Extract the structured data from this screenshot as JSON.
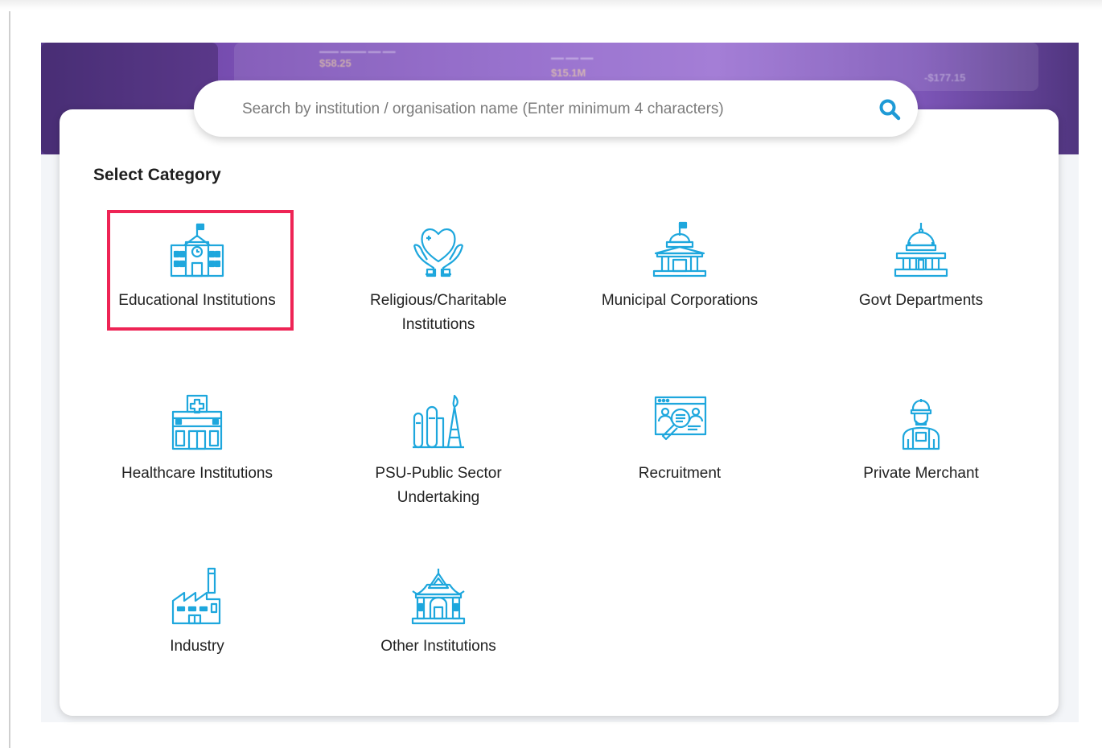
{
  "banner": {
    "metric_1": "$58.25",
    "metric_2": "$15.1M",
    "metric_3": "-$177.15"
  },
  "search": {
    "placeholder": "Search by institution / organisation name (Enter minimum 4 characters)",
    "icon": "search-icon"
  },
  "section_title": "Select Category",
  "categories": [
    {
      "label": "Educational Institutions",
      "icon": "school-icon",
      "selected": true
    },
    {
      "label": "Religious/Charitable Institutions",
      "icon": "heart-hands-icon"
    },
    {
      "label": "Municipal Corporations",
      "icon": "municipal-building-icon"
    },
    {
      "label": "Govt Departments",
      "icon": "capitol-dome-icon"
    },
    {
      "label": "Healthcare Institutions",
      "icon": "hospital-icon"
    },
    {
      "label": "PSU-Public Sector Undertaking",
      "icon": "oil-refinery-icon"
    },
    {
      "label": "Recruitment",
      "icon": "recruitment-search-icon"
    },
    {
      "label": "Private Merchant",
      "icon": "merchant-person-icon"
    },
    {
      "label": "Industry",
      "icon": "factory-icon"
    },
    {
      "label": "Other Institutions",
      "icon": "temple-icon"
    }
  ],
  "colors": {
    "icon": "#1ea7dd",
    "highlight": "#ee2455",
    "banner": "#7a4fb4",
    "search_icon": "#1e9ad6"
  }
}
